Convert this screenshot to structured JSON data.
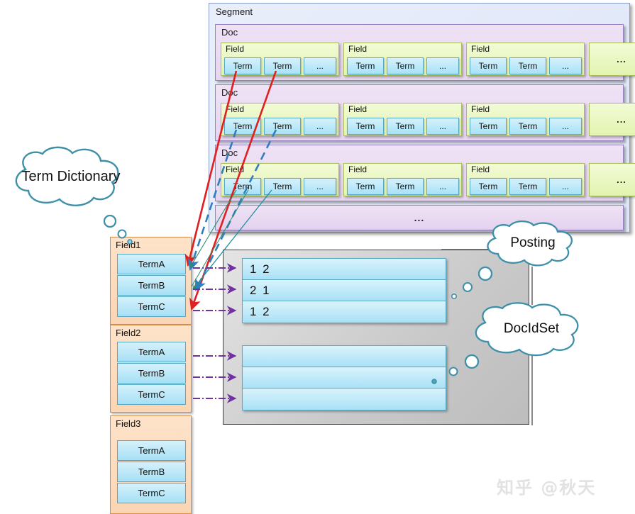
{
  "segment": {
    "title": "Segment",
    "more_label": "...",
    "docs": [
      {
        "title": "Doc",
        "fields": [
          {
            "title": "Field",
            "terms": [
              "Term",
              "Term",
              "..."
            ]
          },
          {
            "title": "Field",
            "terms": [
              "Term",
              "Term",
              "..."
            ]
          },
          {
            "title": "Field",
            "terms": [
              "Term",
              "Term",
              "..."
            ]
          }
        ],
        "more_label": "..."
      },
      {
        "title": "Doc",
        "fields": [
          {
            "title": "Field",
            "terms": [
              "Term",
              "Term",
              "..."
            ]
          },
          {
            "title": "Field",
            "terms": [
              "Term",
              "Term",
              "..."
            ]
          },
          {
            "title": "Field",
            "terms": [
              "Term",
              "Term",
              "..."
            ]
          }
        ],
        "more_label": "..."
      },
      {
        "title": "Doc",
        "fields": [
          {
            "title": "Field",
            "terms": [
              "Term",
              "Term",
              "..."
            ]
          },
          {
            "title": "Field",
            "terms": [
              "Term",
              "Term",
              "..."
            ]
          },
          {
            "title": "Field",
            "terms": [
              "Term",
              "Term",
              "..."
            ]
          }
        ],
        "more_label": "..."
      }
    ]
  },
  "clouds": {
    "term_dictionary": "Term Dictionary",
    "posting": "Posting",
    "docidset": "DocIdSet"
  },
  "term_dictionary": {
    "fields": [
      {
        "title": "Field1",
        "terms": [
          "TermA",
          "TermB",
          "TermC"
        ]
      },
      {
        "title": "Field2",
        "terms": [
          "TermA",
          "TermB",
          "TermC"
        ]
      },
      {
        "title": "Field3",
        "terms": [
          "TermA",
          "TermB",
          "TermC"
        ]
      }
    ]
  },
  "posting": {
    "lists": [
      {
        "rows": [
          "1 2",
          "2 1",
          "1 2"
        ]
      },
      {
        "rows": [
          "",
          "",
          ""
        ]
      }
    ]
  },
  "watermark": "知乎 @秋天",
  "colors": {
    "segment_bg": "#e9eefb",
    "segment_border": "#8a9ec8",
    "doc_bg": "#efe2f5",
    "doc_border": "#9a7fc0",
    "field_bg": "#f2fbd6",
    "field_border": "#a8bf5c",
    "term_bg": "#d5f1fb",
    "term_border": "#5aa9c4",
    "fieldpanel_bg": "#fde3ca",
    "fieldpanel_border": "#d98e48",
    "posting_panel_bg": "#c9c9c9",
    "cloud_stroke": "#3d90a8",
    "arrow_red": "#e02020",
    "arrow_blue": "#2f7fc0",
    "arrow_green": "#2e8b6b",
    "connector_purple": "#7030a0"
  }
}
